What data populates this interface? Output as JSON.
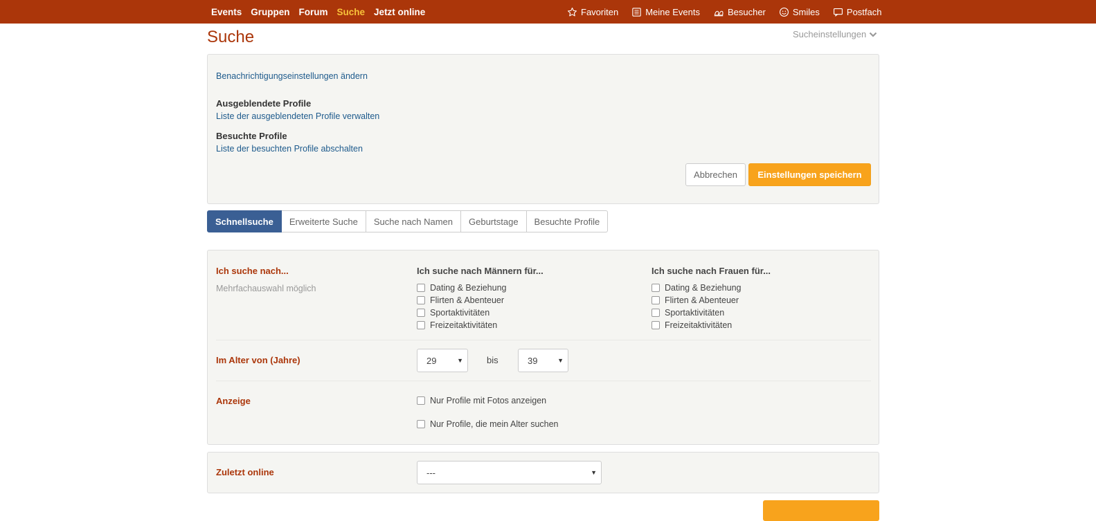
{
  "topnav": {
    "left": [
      "Events",
      "Gruppen",
      "Forum",
      "Suche",
      "Jetzt online"
    ],
    "active_index": 3,
    "right": [
      {
        "label": "Favoriten",
        "icon": "star-icon"
      },
      {
        "label": "Meine Events",
        "icon": "list-icon"
      },
      {
        "label": "Besucher",
        "icon": "footprint-icon"
      },
      {
        "label": "Smiles",
        "icon": "smiley-icon"
      },
      {
        "label": "Postfach",
        "icon": "mailbox-icon"
      }
    ]
  },
  "page": {
    "title": "Suche",
    "settings_toggle": "Sucheinstellungen"
  },
  "settings": {
    "notify_link": "Benachrichtigungseinstellungen ändern",
    "hidden_title": "Ausgeblendete Profile",
    "hidden_link": "Liste der ausgeblendeten Profile verwalten",
    "visited_title": "Besuchte Profile",
    "visited_link": "Liste der besuchten Profile abschalten",
    "cancel_label": "Abbrechen",
    "save_label": "Einstellungen speichern"
  },
  "tabs": [
    "Schnellsuche",
    "Erweiterte Suche",
    "Suche nach Namen",
    "Geburtstage",
    "Besuchte Profile"
  ],
  "search": {
    "looking_for_label": "Ich suche nach...",
    "multi_hint": "Mehrfachauswahl möglich",
    "men_header": "Ich suche nach Männern für...",
    "women_header": "Ich suche nach Frauen für...",
    "options": [
      "Dating & Beziehung",
      "Flirten & Abenteuer",
      "Sportaktivitäten",
      "Freizeitaktivitäten"
    ],
    "age_label": "Im Alter von (Jahre)",
    "age_from": "29",
    "age_to_label": "bis",
    "age_to": "39",
    "display_label": "Anzeige",
    "display_opt1": "Nur Profile mit Fotos anzeigen",
    "display_opt2": "Nur Profile, die mein Alter suchen"
  },
  "online": {
    "label": "Zuletzt online",
    "value": "---"
  },
  "colors": {
    "brand": "#ab360a",
    "accent": "#f8a31c",
    "active_tab": "#3a5f94",
    "link": "#1d5a8c"
  }
}
